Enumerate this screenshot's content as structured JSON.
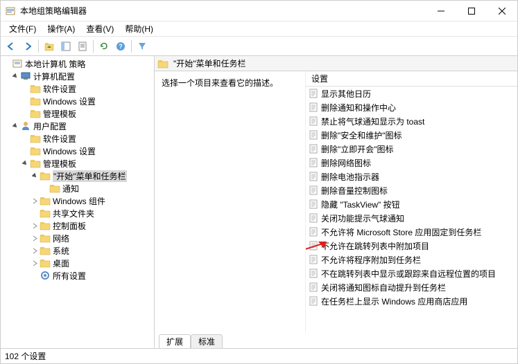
{
  "window": {
    "title": "本地组策略编辑器"
  },
  "menu": {
    "file": "文件(F)",
    "action": "操作(A)",
    "view": "查看(V)",
    "help": "帮助(H)"
  },
  "tree": {
    "root": "本地计算机 策略",
    "computer": "计算机配置",
    "c_soft": "软件设置",
    "c_win": "Windows 设置",
    "c_admin": "管理模板",
    "user": "用户配置",
    "u_soft": "软件设置",
    "u_win": "Windows 设置",
    "u_admin": "管理模板",
    "start": "\"开始\"菜单和任务栏",
    "notify": "通知",
    "wincomp": "Windows 组件",
    "shared": "共享文件夹",
    "ctrlpanel": "控制面板",
    "network": "网络",
    "system": "系统",
    "desktop": "桌面",
    "allset": "所有设置"
  },
  "content": {
    "header": "\"开始\"菜单和任务栏",
    "prompt": "选择一个项目来查看它的描述。",
    "column": "设置",
    "items": [
      "显示其他日历",
      "删除通知和操作中心",
      "禁止将气球通知显示为 toast",
      "删除\"安全和维护\"图标",
      "删除\"立即开会\"图标",
      "删除网络图标",
      "删除电池指示器",
      "删除音量控制图标",
      "隐藏 \"TaskView\" 按钮",
      "关闭功能提示气球通知",
      "不允许将 Microsoft Store 应用固定到任务栏",
      "不允许在跳转列表中附加项目",
      "不允许将程序附加到任务栏",
      "不在跳转列表中显示或跟踪来自远程位置的项目",
      "关闭将通知图标自动提升到任务栏",
      "在任务栏上显示 Windows 应用商店应用"
    ]
  },
  "tabs": {
    "extended": "扩展",
    "standard": "标准"
  },
  "status": "102 个设置"
}
